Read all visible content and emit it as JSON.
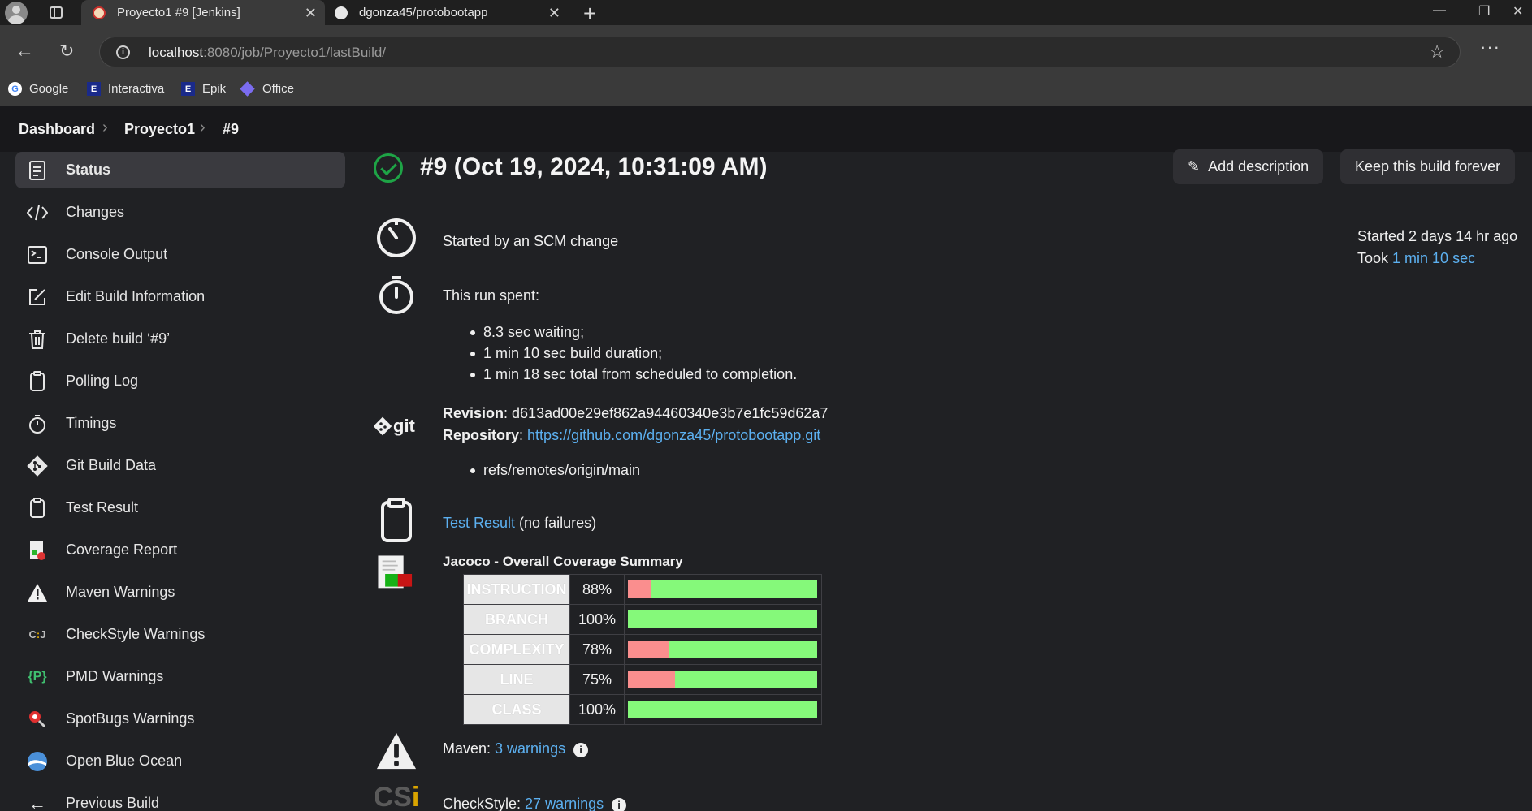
{
  "browser": {
    "tabs": [
      {
        "title": "Proyecto1 #9 [Jenkins]",
        "active": true
      },
      {
        "title": "dgonza45/protobootapp",
        "active": false
      }
    ],
    "url_host": "localhost",
    "url_path": ":8080/job/Proyecto1/lastBuild/",
    "bookmarks": [
      "Google",
      "Interactiva",
      "Epik",
      "Office"
    ]
  },
  "breadcrumb": [
    "Dashboard",
    "Proyecto1",
    "#9"
  ],
  "sidebar": {
    "items": [
      {
        "label": "Status",
        "icon": "status-icon"
      },
      {
        "label": "Changes",
        "icon": "code-icon"
      },
      {
        "label": "Console Output",
        "icon": "terminal-icon"
      },
      {
        "label": "Edit Build Information",
        "icon": "edit-icon"
      },
      {
        "label": "Delete build ‘#9’",
        "icon": "trash-icon"
      },
      {
        "label": "Polling Log",
        "icon": "clipboard-icon"
      },
      {
        "label": "Timings",
        "icon": "stopwatch-icon"
      },
      {
        "label": "Git Build Data",
        "icon": "git-icon"
      },
      {
        "label": "Test Result",
        "icon": "clipboard-icon"
      },
      {
        "label": "Coverage Report",
        "icon": "coverage-icon"
      },
      {
        "label": "Maven Warnings",
        "icon": "warning-icon"
      },
      {
        "label": "CheckStyle Warnings",
        "icon": "checkstyle-icon"
      },
      {
        "label": "PMD Warnings",
        "icon": "pmd-icon"
      },
      {
        "label": "SpotBugs Warnings",
        "icon": "spotbugs-icon"
      },
      {
        "label": "Open Blue Ocean",
        "icon": "blue-ocean-icon"
      },
      {
        "label": "Previous Build",
        "icon": "arrow-left-icon"
      }
    ]
  },
  "build": {
    "title": "#9 (Oct 19, 2024, 10:31:09 AM)",
    "add_description": "Add description",
    "keep_forever": "Keep this build forever",
    "started_by": "Started by an SCM change",
    "started_ago": "Started 2 days 14 hr ago",
    "took_label": "Took ",
    "took_value": "1 min 10 sec",
    "run_spent": "This run spent:",
    "run_items": [
      "8.3 sec waiting;",
      "1 min 10 sec build duration;",
      "1 min 18 sec total from scheduled to completion."
    ],
    "revision_label": "Revision",
    "revision_value": ": d613ad00e29ef862a94460340e3b7e1fc59d62a7",
    "repository_label": "Repository",
    "repository_sep": ": ",
    "repository_url": "https://github.com/dgonza45/protobootapp.git",
    "refs": "refs/remotes/origin/main",
    "test_result_link": "Test Result",
    "test_result_suffix": " (no failures)",
    "jacoco_title": "Jacoco - Overall Coverage Summary",
    "coverage": [
      {
        "label": "INSTRUCTION",
        "pct": "88%",
        "covered": 0.88
      },
      {
        "label": "BRANCH",
        "pct": "100%",
        "covered": 1.0
      },
      {
        "label": "COMPLEXITY",
        "pct": "78%",
        "covered": 0.78
      },
      {
        "label": "LINE",
        "pct": "75%",
        "covered": 0.75
      },
      {
        "label": "CLASS",
        "pct": "100%",
        "covered": 1.0
      }
    ],
    "maven_label": "Maven: ",
    "maven_link": "3 warnings",
    "checkstyle_label": "CheckStyle: ",
    "checkstyle_link": "27 warnings"
  },
  "colors": {
    "success": "#1ea446",
    "link": "#5cb0f0",
    "covered": "#85f97a",
    "missed": "#fa8e8e"
  }
}
